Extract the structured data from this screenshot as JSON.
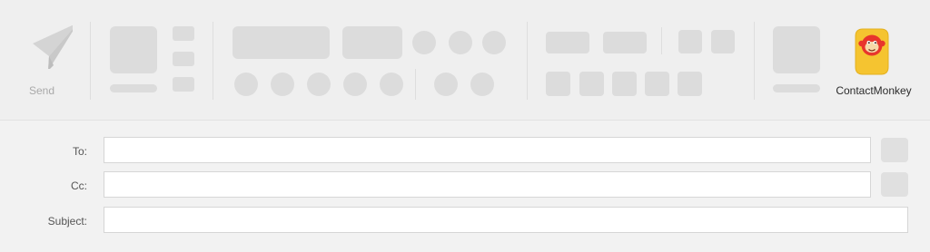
{
  "ribbon": {
    "send": {
      "label": "Send",
      "icon": "paper-plane-icon"
    },
    "addin": {
      "label": "ContactMonkey",
      "icon": "contactmonkey-logo-icon"
    }
  },
  "fields": {
    "to": {
      "label": "To:",
      "value": ""
    },
    "cc": {
      "label": "Cc:",
      "value": ""
    },
    "subject": {
      "label": "Subject:",
      "value": ""
    }
  },
  "colors": {
    "background": "#f2f2f2",
    "placeholder": "#dcdcdc",
    "logo_yellow": "#f5c430",
    "logo_red": "#e8352c"
  }
}
